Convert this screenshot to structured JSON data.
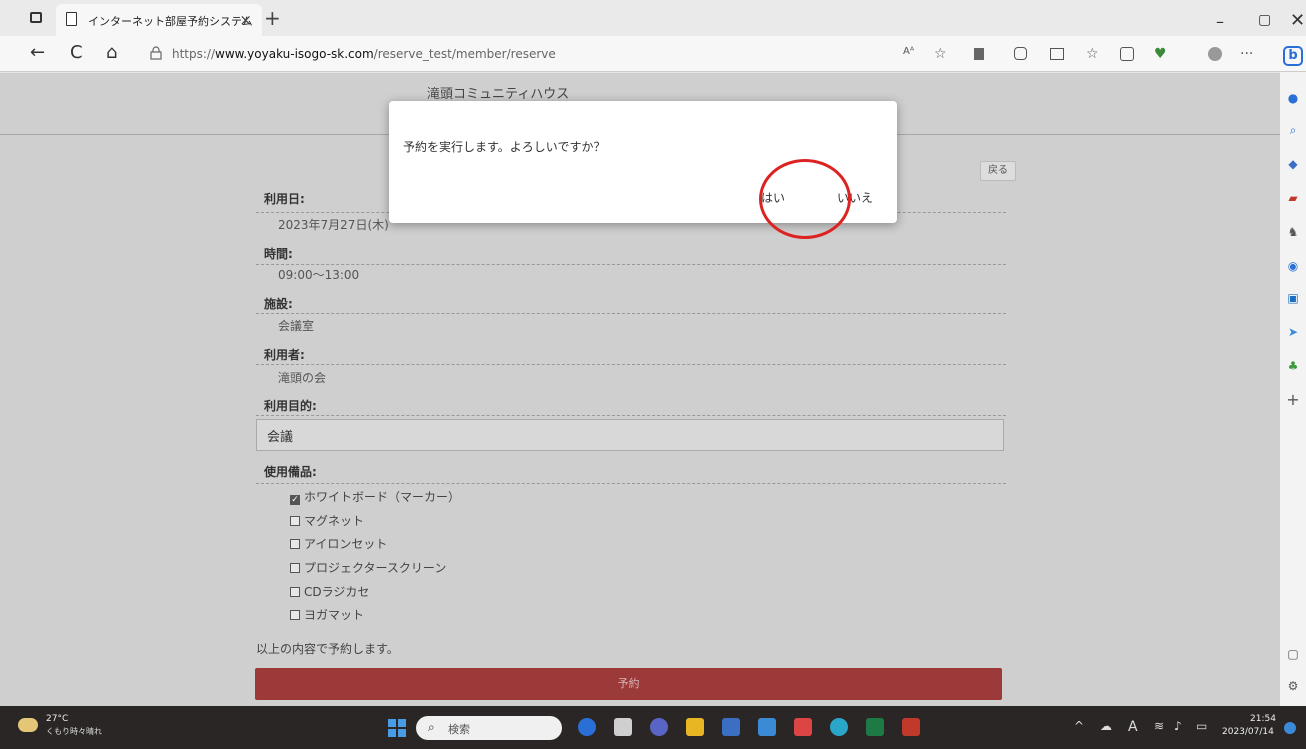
{
  "browser": {
    "tab_title": "インターネット部屋予約システム",
    "tab_close": "×",
    "new_tab": "+",
    "url_prefix": "https://",
    "url_domain": "www.yoyaku-isogo-sk.com",
    "url_path": "/reserve_test/member/reserve",
    "win_min": "–",
    "win_restore": "▢",
    "win_close": "✕",
    "back_icon": "←",
    "reload_icon": "C",
    "home_icon": "⌂",
    "read_aloud": "Aᴬ",
    "favorite_icon": "☆",
    "more_icon": "···"
  },
  "page": {
    "site_title": "滝頭コミュニティハウス",
    "back_button": "戻る",
    "fields": [
      {
        "label": "利用日:",
        "value": "2023年7月27日(木)"
      },
      {
        "label": "時間:",
        "value": "09:00～13:00"
      },
      {
        "label": "施設:",
        "value": "会議室"
      },
      {
        "label": "利用者:",
        "value": "滝頭の会"
      },
      {
        "label": "利用目的:",
        "value": "会議"
      }
    ],
    "equipment_label": "使用備品:",
    "equipment": [
      {
        "name": "ホワイトボード（マーカー）",
        "checked": true
      },
      {
        "name": "マグネット",
        "checked": false
      },
      {
        "name": "アイロンセット",
        "checked": false
      },
      {
        "name": "プロジェクタースクリーン",
        "checked": false
      },
      {
        "name": "CDラジカセ",
        "checked": false
      },
      {
        "name": "ヨガマット",
        "checked": false
      }
    ],
    "confirm_text": "以上の内容で予約します。",
    "reserve_button": "予約"
  },
  "dialog": {
    "message": "予約を実行します。よろしいですか？",
    "yes": "はい",
    "no": "いいえ"
  },
  "taskbar": {
    "temperature": "27°C",
    "weather": "くもり時々晴れ",
    "search_placeholder": "検索",
    "time": "21:54",
    "date": "2023/07/14",
    "ime": "A"
  },
  "colors": {
    "reserve_button": "#9c3a3a",
    "annotation_circle": "#dd2222",
    "taskbar": "#2b2626"
  }
}
